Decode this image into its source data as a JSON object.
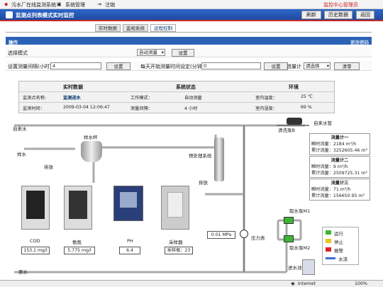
{
  "menubar": {
    "item1": "污水厂在线监测系统",
    "item2": "系统管理",
    "item3": "注销",
    "brand": "监控中心管理员"
  },
  "header": {
    "title": "监测点列表模式实时监控",
    "refresh": "刷新",
    "history": "历史数据",
    "back": "返回"
  },
  "tabs": [
    "实时数据",
    "监视系统",
    "远程控制"
  ],
  "ops": {
    "title": "操作",
    "change_pwd": "更改密码",
    "mode_label": "选择模式",
    "mode_value": "自动测量",
    "set": "设置",
    "interval_label": "设置测量间隔(小时)",
    "interval_value": "4",
    "daily_label": "每天开始测量时间设定(分钟)",
    "daily_value": "0",
    "flowmeter_label": "流量计",
    "flowmeter_placeholder": "请选择",
    "clear": "清零"
  },
  "status": {
    "h1": "实时数据",
    "h2": "系统状态",
    "h3": "环境",
    "r1": [
      "监测点名称:",
      "监测进水",
      "工作模式：",
      "自动测量",
      "室内温度：",
      "25 ℃"
    ],
    "r2": [
      "监测时间：",
      "2009-03-04 12:06:47",
      "测量间隔：",
      "4 小时",
      "室内湿度：",
      "69 %"
    ]
  },
  "diagram": {
    "inflow": "自来水",
    "inflow_right": "自来水管",
    "clean_pump": "清洗泵B",
    "sample_cup": "样水杯",
    "sample_water": "样水",
    "drain": "排放",
    "drain2": "排放",
    "pretreat": "预处理系统",
    "pressure": "压力表",
    "pressure_val": "0.01 MPa",
    "pump1": "取水泵M1",
    "pump2": "取水泵M2",
    "tank": "进水池",
    "raw_water": "原水",
    "flow1": {
      "title": "流量计一",
      "inst": "瞬时流量：2184 m³/h",
      "total": "累计流量：3252605.46 m³"
    },
    "flow2": {
      "title": "流量计二",
      "inst": "瞬时流量：9 m³/h",
      "total": "累计流量：2509725.31 m³"
    },
    "flow3": {
      "title": "流量计三",
      "inst": "瞬时流量：71 m³/h",
      "total": "累计流量：156650.95 m³"
    },
    "instruments": [
      {
        "name": "COD",
        "value": "153.1 mg/l"
      },
      {
        "name": "氨氮",
        "value": "5.775 mg/l"
      },
      {
        "name": "PH",
        "value": "6.4"
      },
      {
        "name": "采样器",
        "value": "采样瓶：23"
      }
    ],
    "legend": [
      {
        "label": "运行",
        "color": "#3db534"
      },
      {
        "label": "停止",
        "color": "#e8c51a"
      },
      {
        "label": "报警",
        "color": "#d22"
      },
      {
        "label": "水流",
        "color": "#3b6fd1"
      }
    ]
  },
  "statusbar": {
    "internet": "Internet",
    "zoom": "100%"
  }
}
